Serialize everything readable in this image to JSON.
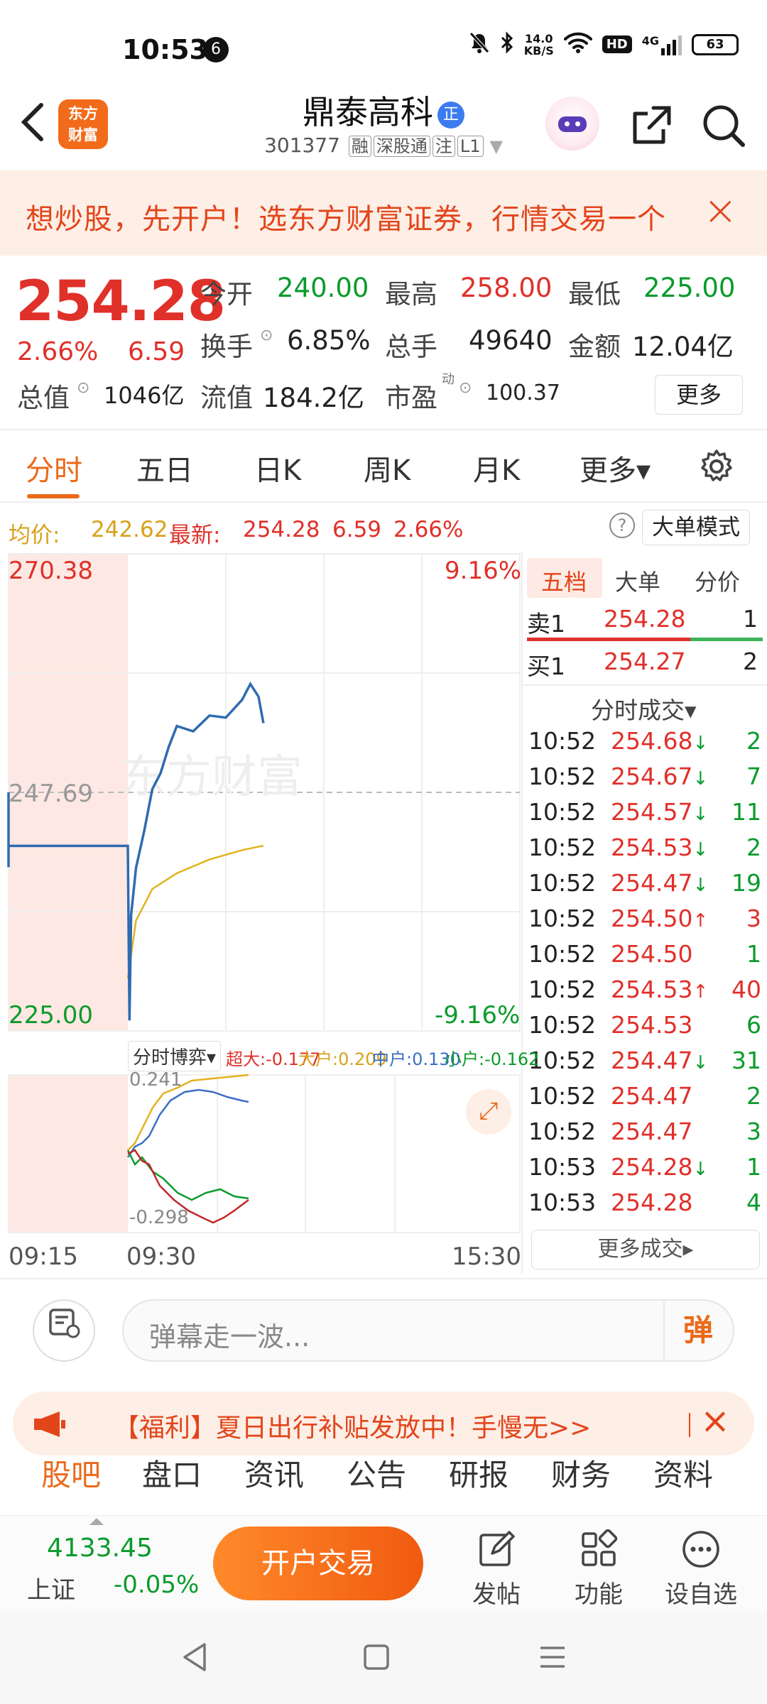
{
  "status_bar": {
    "time": "10:53",
    "notif_count": "6",
    "net_speed_top": "14.0",
    "net_speed_unit": "KB/S",
    "hd": "HD",
    "signal": "4G",
    "battery": "63"
  },
  "header": {
    "logo_text_1": "东方",
    "logo_text_2": "财富",
    "stock_name": "鼎泰高科",
    "name_badge": "正",
    "code": "301377",
    "tags": [
      "融",
      "深股通",
      "注",
      "L1"
    ]
  },
  "banner": {
    "text": "想炒股，先开户！选东方财富证券，行情交易一个",
    "close": "×"
  },
  "quote": {
    "price": "254.28",
    "pct": "2.66%",
    "change": "6.59",
    "open_label": "今开",
    "open": "240.00",
    "high_label": "最高",
    "high": "258.00",
    "low_label": "最低",
    "low": "225.00",
    "turnover_label": "换手",
    "turnover": "6.85%",
    "volume_label": "总手",
    "volume": "49640",
    "amount_label": "金额",
    "amount": "12.04亿",
    "mktcap_label": "总值",
    "mktcap": "1046亿",
    "float_label": "流值",
    "float": "184.2亿",
    "pe_label": "市盈",
    "pe_sup": "动",
    "pe": "100.37",
    "more": "更多"
  },
  "tabs": [
    {
      "label": "分时",
      "active": true
    },
    {
      "label": "五日"
    },
    {
      "label": "日K"
    },
    {
      "label": "周K"
    },
    {
      "label": "月K"
    },
    {
      "label": "更多▾"
    }
  ],
  "avg_bar": {
    "avg_label": "均价:",
    "avg": "242.62",
    "latest_label": "最新:",
    "latest": "254.28",
    "change": "6.59",
    "pct": "2.66%",
    "help": "?",
    "mode": "大单模式"
  },
  "chart": {
    "y_max": "270.38",
    "y_max_pct": "9.16%",
    "y_mid": "247.69",
    "y_min": "225.00",
    "y_min_pct": "-9.16%",
    "watermark": "东方财富",
    "time_start": "09:15",
    "time_open": "09:30",
    "time_end": "15:30"
  },
  "chart_data": {
    "type": "line",
    "ylim": [
      225.0,
      270.38
    ],
    "prev_close": 247.69,
    "series": [
      {
        "name": "最新",
        "x": [
          "09:15",
          "09:25",
          "09:30",
          "09:31",
          "09:32",
          "09:35",
          "09:40",
          "09:45",
          "09:50",
          "09:55",
          "10:00",
          "10:10",
          "10:20",
          "10:30",
          "10:40",
          "10:45",
          "10:50",
          "10:53"
        ],
        "values": [
          242.6,
          242.6,
          242.6,
          226.0,
          236.0,
          240.5,
          244.0,
          248.0,
          249.5,
          252.0,
          254.0,
          253.5,
          255.0,
          254.8,
          256.5,
          258.0,
          256.8,
          254.28
        ]
      },
      {
        "name": "均价",
        "x": [
          "09:30",
          "09:35",
          "09:45",
          "10:00",
          "10:20",
          "10:40",
          "10:53"
        ],
        "values": [
          230.0,
          235.5,
          238.5,
          240.0,
          241.3,
          242.2,
          242.62
        ]
      }
    ]
  },
  "order_book": {
    "tabs": [
      "五档",
      "大单",
      "分价"
    ],
    "sell1_label": "卖1",
    "sell1_price": "254.28",
    "sell1_vol": "1",
    "buy1_label": "买1",
    "buy1_price": "254.27",
    "buy1_vol": "2",
    "trades_title": "分时成交▾",
    "trades": [
      {
        "time": "10:52",
        "price": "254.68↓",
        "vol": "2",
        "dir": "g"
      },
      {
        "time": "10:52",
        "price": "254.67↓",
        "vol": "7",
        "dir": "g"
      },
      {
        "time": "10:52",
        "price": "254.57↓",
        "vol": "11",
        "dir": "g"
      },
      {
        "time": "10:52",
        "price": "254.53↓",
        "vol": "2",
        "dir": "g"
      },
      {
        "time": "10:52",
        "price": "254.47↓",
        "vol": "19",
        "dir": "g"
      },
      {
        "time": "10:52",
        "price": "254.50↑",
        "vol": "3",
        "dir": "r"
      },
      {
        "time": "10:52",
        "price": "254.50",
        "vol": "1",
        "dir": "g"
      },
      {
        "time": "10:52",
        "price": "254.53↑",
        "vol": "40",
        "dir": "r"
      },
      {
        "time": "10:52",
        "price": "254.53",
        "vol": "6",
        "dir": "g"
      },
      {
        "time": "10:52",
        "price": "254.47↓",
        "vol": "31",
        "dir": "g"
      },
      {
        "time": "10:52",
        "price": "254.47",
        "vol": "2",
        "dir": "g"
      },
      {
        "time": "10:52",
        "price": "254.47",
        "vol": "3",
        "dir": "g"
      },
      {
        "time": "10:53",
        "price": "254.28↓",
        "vol": "1",
        "dir": "g"
      },
      {
        "time": "10:53",
        "price": "254.28",
        "vol": "4",
        "dir": "g"
      }
    ],
    "more_trades": "更多成交▸"
  },
  "sub_chart": {
    "selector": "分时博弈▾",
    "legend": [
      {
        "text": "超大:-0.177",
        "color": "#e0302a"
      },
      {
        "text": "大户:0.209",
        "color": "#e3b21d"
      },
      {
        "text": "中户:0.130",
        "color": "#3a6fc4"
      },
      {
        "text": "小户:-0.162",
        "color": "#0a9b2c"
      }
    ],
    "y_top": "0.241",
    "y_bottom": "-0.298"
  },
  "danmu": {
    "placeholder": "弹幕走一波...",
    "send": "弹"
  },
  "promo": {
    "text": "【福利】夏日出行补贴发放中！手慢无>>",
    "close": "×"
  },
  "bottom_tabs": [
    "股吧",
    "盘口",
    "资讯",
    "公告",
    "研报",
    "财务",
    "资料"
  ],
  "bottom_bar": {
    "index_value": "4133.45",
    "index_name": "上证",
    "index_change": "-0.05%",
    "trade": "开户交易",
    "post": "发帖",
    "func": "功能",
    "watchlist": "设自选"
  }
}
